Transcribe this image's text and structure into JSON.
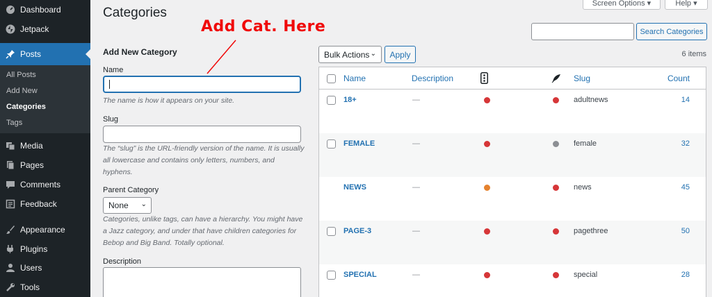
{
  "sidebar": {
    "items": [
      {
        "label": "Dashboard",
        "icon": "dashboard-icon"
      },
      {
        "label": "Jetpack",
        "icon": "jetpack-icon"
      },
      {
        "label": "Posts",
        "icon": "pin-icon"
      },
      {
        "label": "Media",
        "icon": "media-icon"
      },
      {
        "label": "Pages",
        "icon": "pages-icon"
      },
      {
        "label": "Comments",
        "icon": "comments-icon"
      },
      {
        "label": "Feedback",
        "icon": "feedback-icon"
      },
      {
        "label": "Appearance",
        "icon": "brush-icon"
      },
      {
        "label": "Plugins",
        "icon": "plugin-icon"
      },
      {
        "label": "Users",
        "icon": "users-icon"
      },
      {
        "label": "Tools",
        "icon": "wrench-icon"
      }
    ],
    "submenu": [
      "All Posts",
      "Add New",
      "Categories",
      "Tags"
    ]
  },
  "header": {
    "title": "Categories",
    "screen_options": "Screen Options ▾",
    "help": "Help ▾",
    "annotation": "Add Cat. Here"
  },
  "form": {
    "heading": "Add New Category",
    "name_label": "Name",
    "name_help": "The name is how it appears on your site.",
    "slug_label": "Slug",
    "slug_help": "The “slug” is the URL-friendly version of the name. It is usually all lowercase and contains only letters, numbers, and hyphens.",
    "parent_label": "Parent Category",
    "parent_value": "None",
    "parent_help": "Categories, unlike tags, can have a hierarchy. You might have a Jazz category, and under that have children categories for Bebop and Big Band. Totally optional.",
    "description_label": "Description"
  },
  "list": {
    "search_button": "Search Categories",
    "bulk_actions": "Bulk Actions",
    "apply": "Apply",
    "items_count": "6 items",
    "columns": {
      "name": "Name",
      "description": "Description",
      "slug": "Slug",
      "count": "Count"
    },
    "rows": [
      {
        "name": "18+",
        "description": "—",
        "slug": "adultnews",
        "count": "14",
        "dot1": "#d63638",
        "dot2": "#d63638",
        "checkbox": true
      },
      {
        "name": "FEMALE",
        "description": "—",
        "slug": "female",
        "count": "32",
        "dot1": "#d63638",
        "dot2": "#8c8f94",
        "checkbox": true
      },
      {
        "name": "NEWS",
        "description": "—",
        "slug": "news",
        "count": "45",
        "dot1": "#e5822e",
        "dot2": "#d63638",
        "checkbox": false
      },
      {
        "name": "PAGE-3",
        "description": "—",
        "slug": "pagethree",
        "count": "50",
        "dot1": "#d63638",
        "dot2": "#d63638",
        "checkbox": true
      },
      {
        "name": "SPECIAL",
        "description": "—",
        "slug": "special",
        "count": "28",
        "dot1": "#d63638",
        "dot2": "#d63638",
        "checkbox": true
      }
    ]
  },
  "colors": {
    "accent": "#2271b1",
    "annotation": "#f00a0a",
    "sidebar": "#1d2327"
  }
}
